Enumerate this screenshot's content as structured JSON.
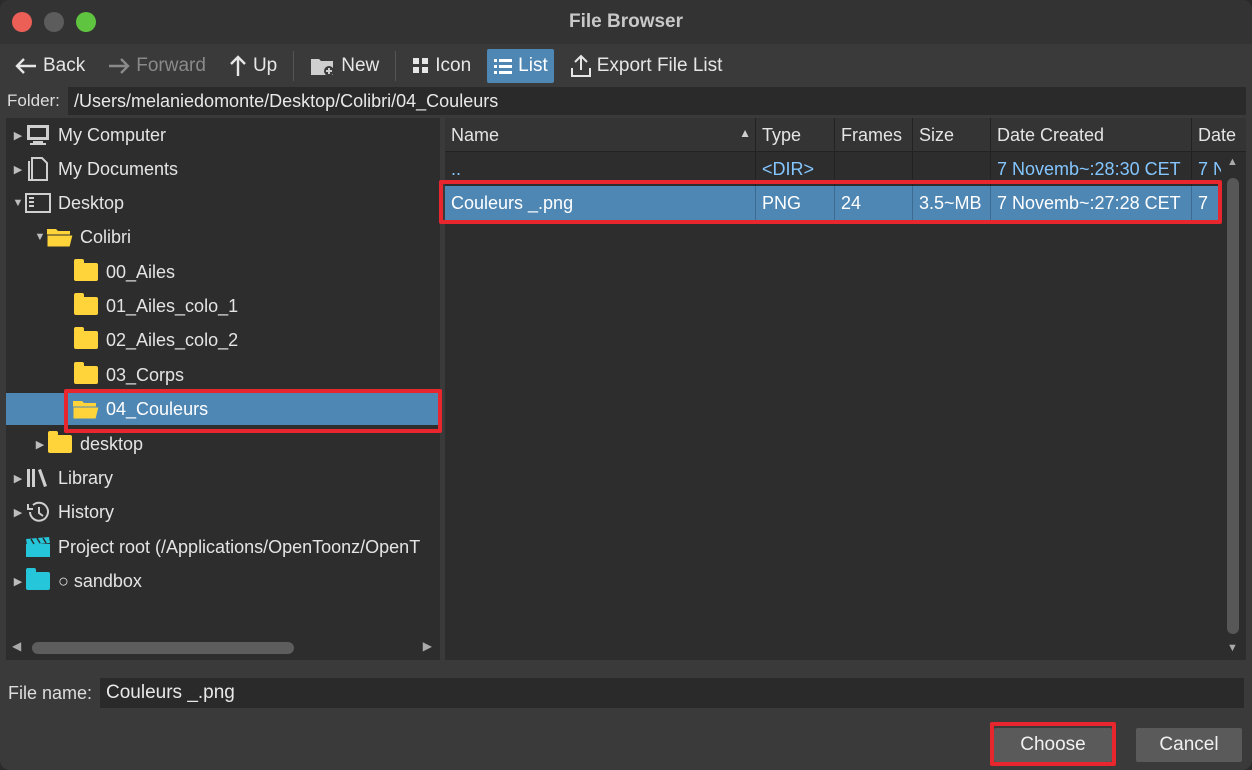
{
  "window": {
    "title": "File Browser"
  },
  "toolbar": {
    "back": "Back",
    "forward": "Forward",
    "up": "Up",
    "new": "New",
    "icon": "Icon",
    "list": "List",
    "export": "Export File List"
  },
  "folder": {
    "label": "Folder:",
    "path": "/Users/melaniedomonte/Desktop/Colibri/04_Couleurs"
  },
  "tree": {
    "items": [
      {
        "label": "My Computer"
      },
      {
        "label": "My Documents"
      },
      {
        "label": "Desktop"
      },
      {
        "label": "Colibri"
      },
      {
        "label": "00_Ailes"
      },
      {
        "label": "01_Ailes_colo_1"
      },
      {
        "label": "02_Ailes_colo_2"
      },
      {
        "label": "03_Corps"
      },
      {
        "label": "04_Couleurs"
      },
      {
        "label": "desktop"
      },
      {
        "label": "Library"
      },
      {
        "label": "History"
      },
      {
        "label": "Project root (/Applications/OpenToonz/OpenT"
      },
      {
        "label": "○ sandbox"
      }
    ]
  },
  "list": {
    "columns": [
      "Name",
      "Type",
      "Frames",
      "Size",
      "Date Created",
      "Date"
    ],
    "rows": [
      {
        "name": "..",
        "type": "<DIR>",
        "frames": "",
        "size": "",
        "created": "7 Novemb~:28:30 CET",
        "date": "7 N"
      },
      {
        "name": "Couleurs _.png",
        "type": "PNG",
        "frames": "24",
        "size": "3.5~MB",
        "created": "7 Novemb~:27:28 CET",
        "date": "7"
      }
    ]
  },
  "filename": {
    "label": "File name:",
    "value": "Couleurs _.png"
  },
  "buttons": {
    "choose": "Choose",
    "cancel": "Cancel"
  },
  "colors": {
    "accent": "#4f87b4",
    "highlight": "#e8262e",
    "dir_text": "#84c6ff",
    "folder": "#ffd43b",
    "sandbox_folder": "#26c6da"
  }
}
